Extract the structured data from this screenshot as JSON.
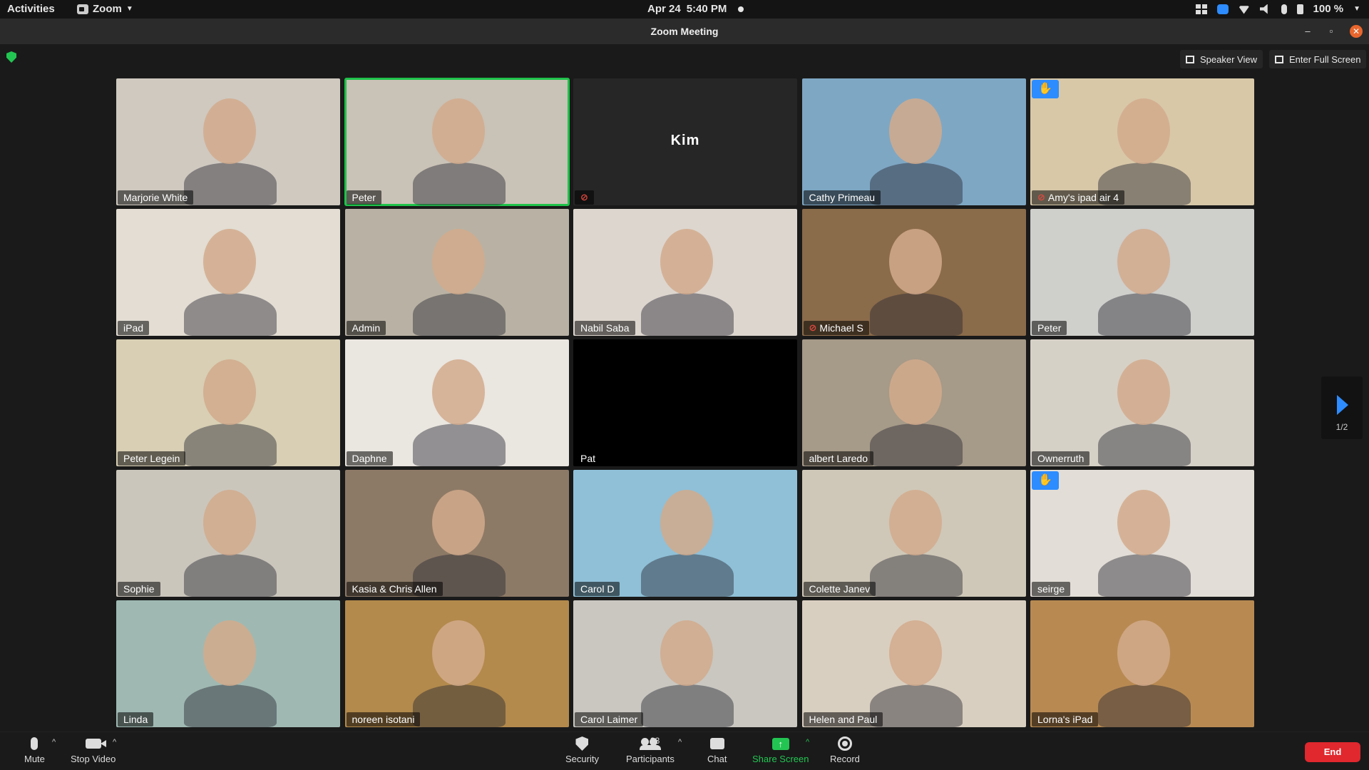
{
  "topbar": {
    "activities": "Activities",
    "app_name": "Zoom",
    "date": "Apr 24",
    "time": "5:40 PM",
    "battery": "100 %"
  },
  "window": {
    "title": "Zoom Meeting",
    "minimize": "–",
    "maximize": "▫",
    "close": "✕"
  },
  "view_controls": {
    "speaker_view": "Speaker View",
    "full_screen": "Enter Full Screen"
  },
  "participants": [
    {
      "name": "Marjorie White",
      "muted": false,
      "hand": false,
      "active": false,
      "bg": "#cfc9c0"
    },
    {
      "name": "Peter",
      "muted": false,
      "hand": false,
      "active": true,
      "bg": "#c9c2b6"
    },
    {
      "name": "",
      "center_name": "Kim",
      "muted": true,
      "hand": false,
      "active": false,
      "bg": "#262626"
    },
    {
      "name": "Cathy Primeau",
      "muted": false,
      "hand": false,
      "active": false,
      "bg": "#7ea7c4"
    },
    {
      "name": "Amy's ipad air 4",
      "muted": true,
      "hand": true,
      "active": false,
      "bg": "#d8c8a8"
    },
    {
      "name": "iPad",
      "muted": false,
      "hand": false,
      "active": false,
      "bg": "#e3ddd3"
    },
    {
      "name": "Admin",
      "muted": false,
      "hand": false,
      "active": false,
      "bg": "#b9b2a4"
    },
    {
      "name": "Nabil Saba",
      "muted": false,
      "hand": false,
      "active": false,
      "bg": "#ddd6cf"
    },
    {
      "name": "Michael S",
      "muted": true,
      "hand": false,
      "active": false,
      "bg": "#8a6b4a"
    },
    {
      "name": "Peter",
      "muted": false,
      "hand": false,
      "active": false,
      "bg": "#cfcfcc"
    },
    {
      "name": "Peter Legein",
      "muted": false,
      "hand": false,
      "active": false,
      "bg": "#d8cfb4"
    },
    {
      "name": "Daphne",
      "muted": false,
      "hand": false,
      "active": false,
      "bg": "#eae6e0"
    },
    {
      "name": "Pat",
      "muted": false,
      "hand": false,
      "active": false,
      "bg": "#000000"
    },
    {
      "name": "albert Laredo",
      "muted": false,
      "hand": false,
      "active": false,
      "bg": "#a69a88"
    },
    {
      "name": "Ownerruth",
      "muted": false,
      "hand": false,
      "active": false,
      "bg": "#d6d1c7"
    },
    {
      "name": "Sophie",
      "muted": false,
      "hand": false,
      "active": false,
      "bg": "#cbc6bc"
    },
    {
      "name": "Kasia & Chris Allen",
      "muted": false,
      "hand": false,
      "active": false,
      "bg": "#8d7a66"
    },
    {
      "name": "Carol D",
      "muted": false,
      "hand": false,
      "active": false,
      "bg": "#8fc0d8"
    },
    {
      "name": "Colette Janev",
      "muted": false,
      "hand": false,
      "active": false,
      "bg": "#cfc8b8"
    },
    {
      "name": "seirge",
      "muted": false,
      "hand": true,
      "active": false,
      "bg": "#e2ddd6"
    },
    {
      "name": "Linda",
      "muted": false,
      "hand": false,
      "active": false,
      "bg": "#9fb9b2"
    },
    {
      "name": "noreen isotani",
      "muted": false,
      "hand": false,
      "active": false,
      "bg": "#b38a4c"
    },
    {
      "name": "Carol Laimer",
      "muted": false,
      "hand": false,
      "active": false,
      "bg": "#c9c7c0"
    },
    {
      "name": "Helen and Paul",
      "muted": false,
      "hand": false,
      "active": false,
      "bg": "#d9cfc0"
    },
    {
      "name": "Lorna's iPad",
      "muted": false,
      "hand": false,
      "active": false,
      "bg": "#b88a52"
    }
  ],
  "pagination": {
    "label": "1/2"
  },
  "toolbar": {
    "mute": "Mute",
    "stop_video": "Stop Video",
    "security": "Security",
    "participants": "Participants",
    "participants_count": "33",
    "chat": "Chat",
    "share_screen": "Share Screen",
    "record": "Record",
    "end": "End"
  },
  "colors": {
    "accent": "#2d8cff",
    "active_speaker": "#1fc24a",
    "end": "#e0282e",
    "share": "#23c552"
  }
}
